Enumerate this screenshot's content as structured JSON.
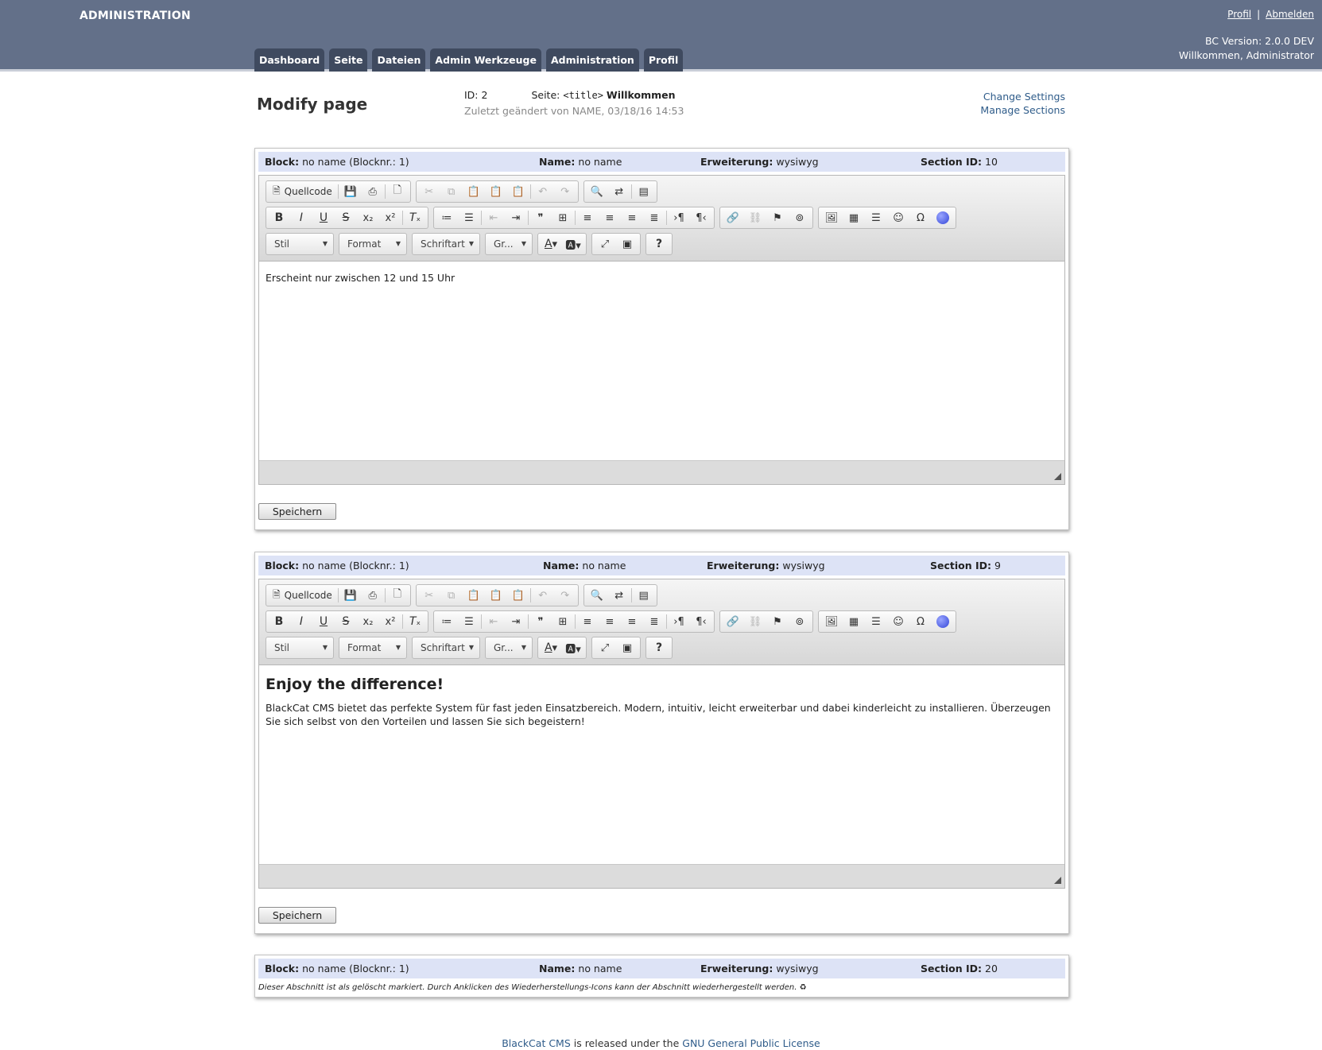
{
  "header": {
    "brand": "ADMINISTRATION",
    "links": {
      "profile": "Profil",
      "separator": "|",
      "logout": "Abmelden"
    },
    "version": "BC Version: 2.0.0 DEV",
    "welcome": "Willkommen, Administrator",
    "nav": [
      "Dashboard",
      "Seite",
      "Dateien",
      "Admin Werkzeuge",
      "Administration",
      "Profil"
    ]
  },
  "page": {
    "title": "Modify page",
    "id_label": "ID: 2",
    "seite_label": "Seite:",
    "seite_tag": "<title>",
    "seite_name": "Willkommen",
    "modified": "Zuletzt geändert von NAME, 03/18/16 14:53",
    "change_settings": "Change Settings",
    "manage_sections": "Manage Sections"
  },
  "labels": {
    "block": "Block:",
    "name": "Name:",
    "extension": "Erweiterung:",
    "section_id": "Section ID:",
    "save": "Speichern"
  },
  "toolbar": {
    "source": "Quellcode",
    "style": "Stil",
    "format": "Format",
    "font": "Schriftart",
    "size": "Gr..."
  },
  "sections": [
    {
      "block": "no name (Blocknr.: 1)",
      "name": "no name",
      "extension": "wysiwyg",
      "section_id": "10",
      "text": "Erscheint nur zwischen 12 und 15 Uhr"
    },
    {
      "block": "no name (Blocknr.: 1)",
      "name": "no name",
      "extension": "wysiwyg",
      "section_id": "9",
      "heading": "Enjoy the difference!",
      "text": "BlackCat CMS bietet das perfekte System für fast jeden Einsatzbereich. Modern, intuitiv, leicht erweiterbar und dabei kinderleicht zu installieren. Überzeugen Sie sich selbst von den Vorteilen und lassen Sie sich begeistern!"
    },
    {
      "block": "no name (Blocknr.: 1)",
      "name": "no name",
      "extension": "wysiwyg",
      "section_id": "20",
      "note": "Dieser Abschnitt ist als gelöscht markiert. Durch Anklicken des Wiederherstellungs-Icons kann der Abschnitt wiederhergestellt werden."
    }
  ],
  "footer": {
    "cms": "BlackCat CMS",
    "middle": " is released under the ",
    "license": "GNU General Public License"
  }
}
